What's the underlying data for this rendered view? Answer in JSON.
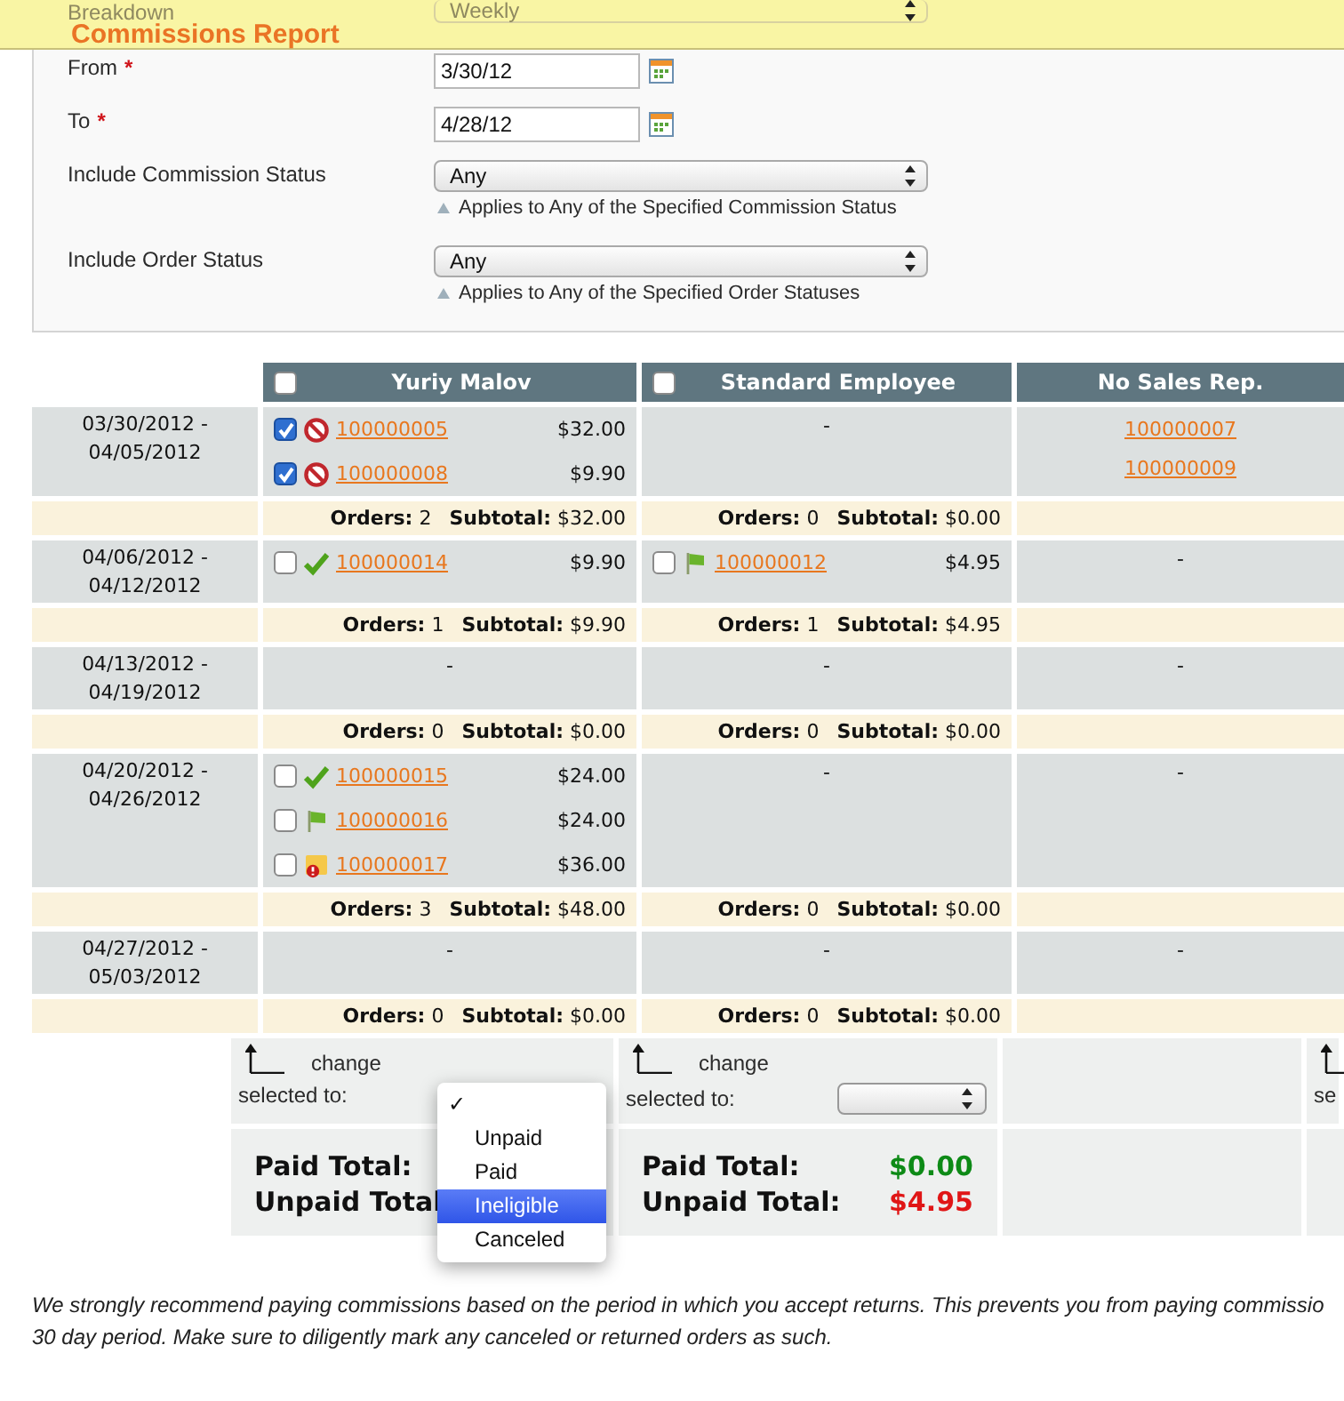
{
  "page_title": "Commissions Report",
  "filters": [
    {
      "kind": "select",
      "label": "Breakdown",
      "value": "Weekly",
      "under_header": true
    },
    {
      "kind": "date",
      "label": "From",
      "required_mark": "*",
      "value": "3/30/12"
    },
    {
      "kind": "date",
      "label": "To",
      "required_mark": "*",
      "value": "4/28/12"
    },
    {
      "kind": "select",
      "label": "Include Commission Status",
      "value": "Any",
      "hint": "Applies to Any of the Specified Commission Status"
    },
    {
      "kind": "select",
      "label": "Include Order Status",
      "value": "Any",
      "hint": "Applies to Any of the Specified Order Statuses"
    }
  ],
  "table": {
    "columns": [
      {
        "name": "Yuriy Malov",
        "checkbox": true,
        "checked": false
      },
      {
        "name": "Standard Employee",
        "checkbox": true,
        "checked": false
      },
      {
        "name": "No Sales Rep.",
        "checkbox": false
      }
    ],
    "periods": [
      {
        "dates": "03/30/2012 - 04/05/2012",
        "cells": [
          {
            "orders": [
              {
                "checked": true,
                "kind": "canceled",
                "number": "100000005",
                "amount": "$32.00"
              },
              {
                "checked": true,
                "kind": "canceled",
                "number": "100000008",
                "amount": "$9.90"
              }
            ]
          },
          {
            "text": "-"
          },
          {
            "orders": [
              {
                "number": "100000007"
              },
              {
                "number": "100000009"
              }
            ]
          }
        ],
        "subtotals": [
          {
            "orders": "**Orders:** 2",
            "subtotal": "**Subtotal:** $32.00"
          },
          {
            "orders": "**Orders:** 0",
            "subtotal": "**Subtotal:** $0.00"
          }
        ]
      },
      {
        "dates": "04/06/2012 - 04/12/2012",
        "cells": [
          {
            "orders": [
              {
                "checked": false,
                "kind": "paid",
                "number": "100000014",
                "amount": "$9.90"
              }
            ]
          },
          {
            "orders": [
              {
                "checked": false,
                "kind": "unpaid",
                "number": "100000012",
                "amount": "$4.95"
              }
            ]
          },
          {
            "text": "-"
          }
        ],
        "subtotals": [
          {
            "orders": "**Orders:** 1",
            "subtotal": "**Subtotal:** $9.90"
          },
          {
            "orders": "**Orders:** 1",
            "subtotal": "**Subtotal:** $4.95"
          }
        ]
      },
      {
        "dates": "04/13/2012 - 04/19/2012",
        "cells": [
          {
            "text": "-"
          },
          {
            "text": "-"
          },
          {
            "text": "-"
          }
        ],
        "subtotals": [
          {
            "orders": "**Orders:** 0",
            "subtotal": "**Subtotal:** $0.00"
          },
          {
            "orders": "**Orders:** 0",
            "subtotal": "**Subtotal:** $0.00"
          }
        ]
      },
      {
        "dates": "04/20/2012 - 04/26/2012",
        "cells": [
          {
            "orders": [
              {
                "checked": false,
                "kind": "paid",
                "number": "100000015",
                "amount": "$24.00"
              },
              {
                "checked": false,
                "kind": "unpaid",
                "number": "100000016",
                "amount": "$24.00"
              },
              {
                "checked": false,
                "kind": "ineligible",
                "number": "100000017",
                "amount": "$36.00"
              }
            ]
          },
          {
            "text": "-"
          },
          {
            "text": "-"
          }
        ],
        "subtotals": [
          {
            "orders": "**Orders:** 3",
            "subtotal": "**Subtotal:** $48.00"
          },
          {
            "orders": "**Orders:** 0",
            "subtotal": "**Subtotal:** $0.00"
          }
        ]
      },
      {
        "dates": "04/27/2012 - 05/03/2012",
        "cells": [
          {
            "text": "-"
          },
          {
            "text": "-"
          },
          {
            "text": "-"
          }
        ],
        "subtotals": [
          {
            "orders": "**Orders:** 0",
            "subtotal": "**Subtotal:** $0.00"
          },
          {
            "orders": "**Orders:** 0",
            "subtotal": "**Subtotal:** $0.00"
          }
        ]
      }
    ]
  },
  "bulk": [
    {
      "kind": "action",
      "arrow": true,
      "change": "change",
      "selected_to": "selected to:",
      "menu": {
        "options": [
          {
            "checked": true,
            "selected": false
          },
          {
            "label": "Unpaid",
            "checked": false,
            "selected": false
          },
          {
            "label": "Paid",
            "checked": false,
            "selected": false
          },
          {
            "label": "Ineligible",
            "checked": false,
            "selected": true
          },
          {
            "label": "Canceled",
            "checked": false,
            "selected": false
          }
        ],
        "check_glyph": "✓"
      },
      "totals": {
        "paid_label": "Paid Total:",
        "unpaid_label": "Unpaid Total"
      }
    },
    {
      "kind": "action",
      "arrow": true,
      "change": "change",
      "selected_to": "selected to:",
      "select": true,
      "totals": {
        "paid_label": "Paid Total:",
        "paid": "$0.00",
        "unpaid_label": "Unpaid Total:",
        "unpaid": "$4.95"
      }
    },
    {
      "kind": "blank"
    },
    {
      "kind": "action",
      "arrow": true,
      "selected_to": "se"
    }
  ],
  "note_lines": [
    "We strongly recommend paying commissions based on the period in which you accept returns. This prevents you from paying commissio",
    "30 day period. Make sure to diligently mark any canceled or returned orders as such."
  ]
}
